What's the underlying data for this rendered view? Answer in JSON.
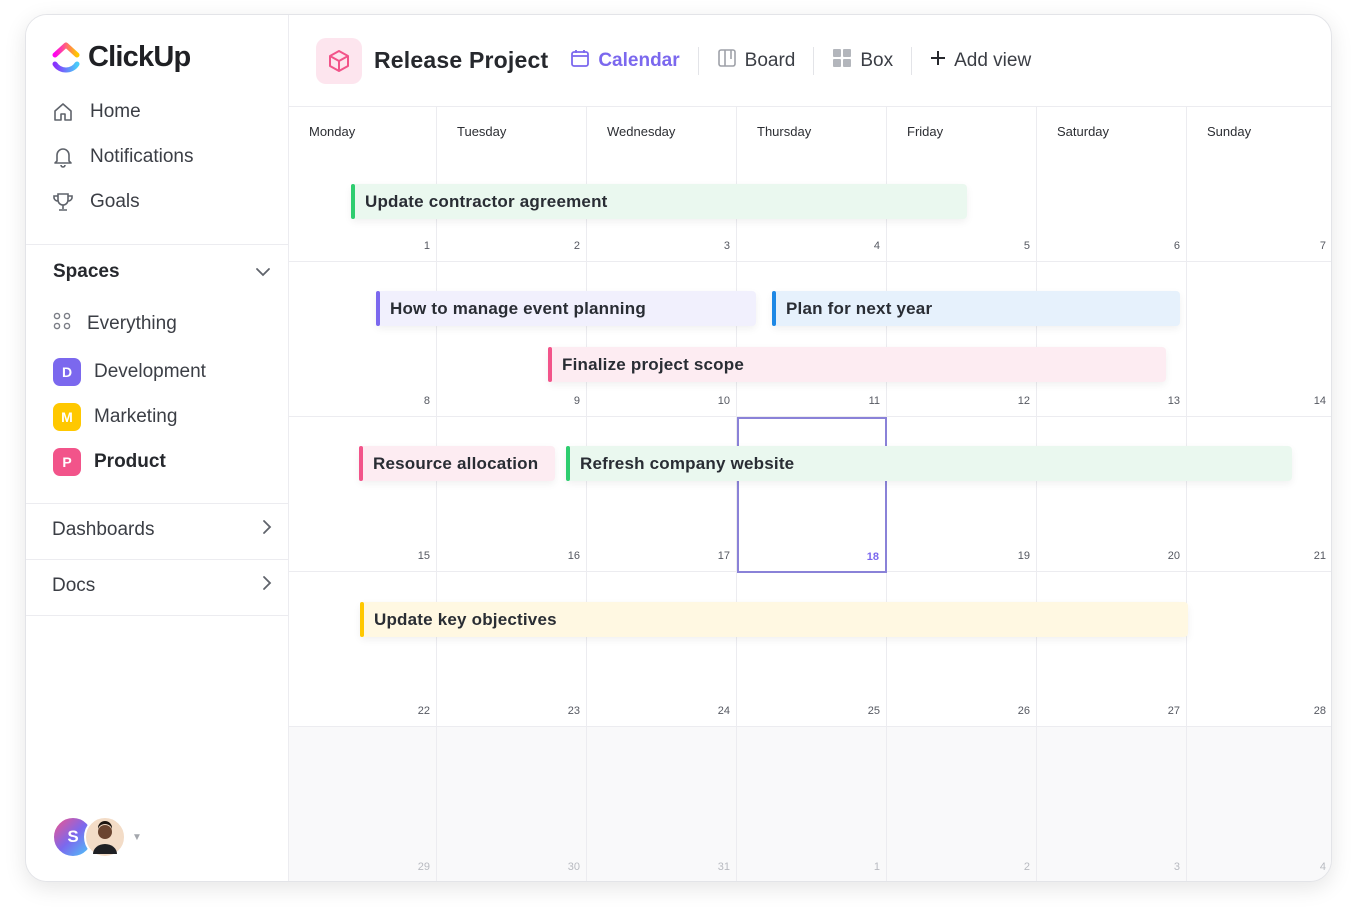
{
  "app": {
    "name": "ClickUp"
  },
  "nav": [
    {
      "label": "Home",
      "icon": "home-icon"
    },
    {
      "label": "Notifications",
      "icon": "bell-icon"
    },
    {
      "label": "Goals",
      "icon": "trophy-icon"
    }
  ],
  "spaces": {
    "title": "Spaces",
    "items": [
      {
        "label": "Everything",
        "badge": "",
        "color": ""
      },
      {
        "label": "Development",
        "badge": "D",
        "color": "#7b68ee"
      },
      {
        "label": "Marketing",
        "badge": "M",
        "color": "#ffc800"
      },
      {
        "label": "Product",
        "badge": "P",
        "color": "#f2548a"
      }
    ]
  },
  "sections": [
    {
      "label": "Dashboards"
    },
    {
      "label": "Docs"
    }
  ],
  "user": {
    "initial": "S"
  },
  "header": {
    "project_title": "Release Project",
    "views": [
      {
        "label": "Calendar",
        "icon": "calendar-icon",
        "active": true
      },
      {
        "label": "Board",
        "icon": "board-icon",
        "active": false
      },
      {
        "label": "Box",
        "icon": "box-icon",
        "active": false
      }
    ],
    "add_view": "Add view"
  },
  "calendar": {
    "days": [
      "Monday",
      "Tuesday",
      "Wednesday",
      "Thursday",
      "Friday",
      "Saturday",
      "Sunday"
    ],
    "weeks": [
      [
        "1",
        "2",
        "3",
        "4",
        "5",
        "6",
        "7"
      ],
      [
        "8",
        "9",
        "10",
        "11",
        "12",
        "13",
        "14"
      ],
      [
        "15",
        "16",
        "17",
        "18",
        "19",
        "20",
        "21"
      ],
      [
        "22",
        "23",
        "24",
        "25",
        "26",
        "27",
        "28"
      ],
      [
        "29",
        "30",
        "31",
        "1",
        "2",
        "3",
        "4"
      ]
    ],
    "today": "18",
    "events": [
      {
        "title": "Update contractor agreement",
        "color": "#2ecd6f",
        "bg": "#eaf8ef"
      },
      {
        "title": "How to manage event planning",
        "color": "#7b68ee",
        "bg": "#f1f0fd"
      },
      {
        "title": "Plan for next year",
        "color": "#1e88e5",
        "bg": "#e6f1fc"
      },
      {
        "title": "Finalize project scope",
        "color": "#f2548a",
        "bg": "#fdecf2"
      },
      {
        "title": "Resource allocation",
        "color": "#f2548a",
        "bg": "#fdecf2"
      },
      {
        "title": "Refresh company website",
        "color": "#2ecd6f",
        "bg": "#eaf8ef"
      },
      {
        "title": "Update key objectives",
        "color": "#ffc800",
        "bg": "#fff8e2"
      }
    ]
  }
}
